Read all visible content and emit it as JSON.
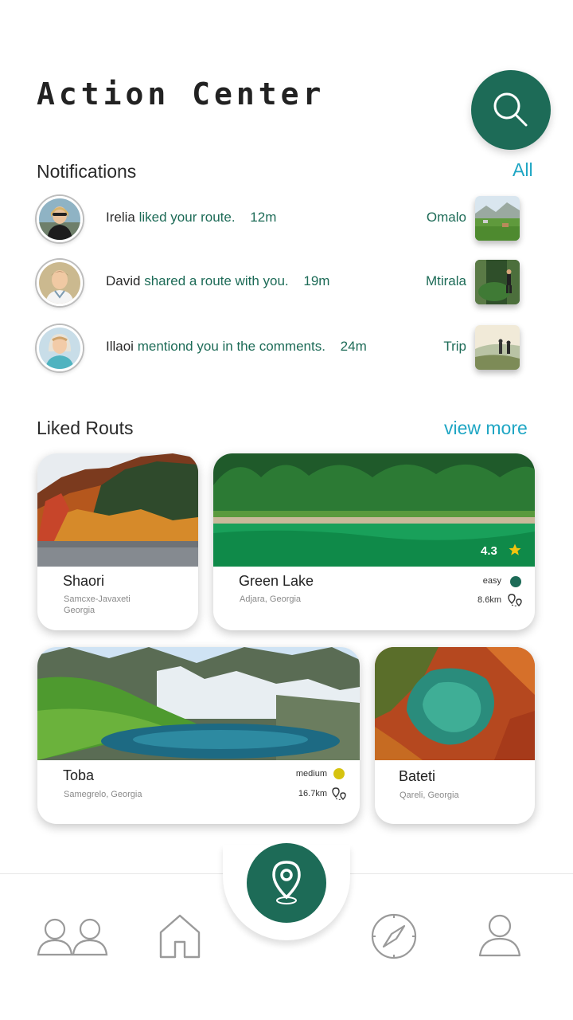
{
  "header": {
    "title": "Action Center"
  },
  "notifications": {
    "title": "Notifications",
    "all_label": "All",
    "items": [
      {
        "name": "Irelia",
        "action": "liked your route.",
        "time": "12m",
        "route": "Omalo"
      },
      {
        "name": "David",
        "action": "shared a route with you.",
        "time": "19m",
        "route": "Mtirala"
      },
      {
        "name": "Illaoi",
        "action": "mentiond you in the comments.",
        "time": "24m",
        "route": "Trip"
      }
    ]
  },
  "liked": {
    "title": "Liked Routs",
    "view_more": "view more",
    "cards": [
      {
        "name": "Shaori",
        "location_line1": "Samcxe-Javaxeti",
        "location_line2": "Georgia"
      },
      {
        "name": "Green Lake",
        "location": "Adjara, Georgia",
        "difficulty": "easy",
        "distance": "8.6km",
        "rating": "4.3"
      },
      {
        "name": "Toba",
        "location": "Samegrelo, Georgia",
        "difficulty": "medium",
        "distance": "16.7km"
      },
      {
        "name": "Bateti",
        "location": "Qareli, Georgia"
      }
    ]
  },
  "colors": {
    "primary": "#1d6b57",
    "accent": "#1fa6c4",
    "easy": "#1d6b57",
    "medium": "#d6c30f",
    "star": "#f2c40f"
  },
  "icons": {
    "search": "search-icon",
    "friends": "friends-icon",
    "home": "home-icon",
    "location": "location-pin-icon",
    "compass": "compass-icon",
    "profile": "profile-icon"
  }
}
